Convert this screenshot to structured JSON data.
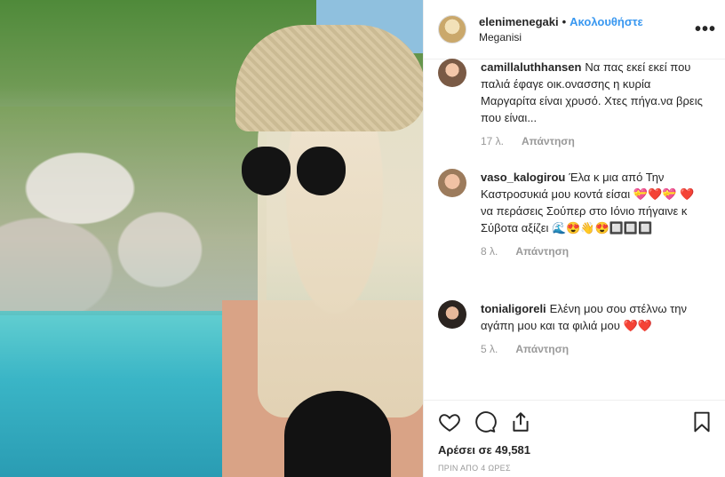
{
  "header": {
    "username": "elenimenegaki",
    "separator": "•",
    "follow_label": "Ακολουθήστε",
    "location": "Meganisi",
    "more_label": "•••"
  },
  "comments": [
    {
      "username": "camillaluthhansen",
      "text": "Να πας εκεί εκεί που παλιά έφαγε οικ.ονασσης η κυρία Μαργαρίτα είναι χρυσό. Χτες πήγα.να βρεις που είναι...",
      "age": "17 λ.",
      "reply": "Απάντηση"
    },
    {
      "username": "vaso_kalogirou",
      "text": "Έλα κ μια από Την Καστροσυκιά μου κοντά είσαι 💝❤️💝 ❤️ να περάσεις Σούπερ στο Ιόνιο πήγαινε κ Σύβοτα αξίζει 🌊😍👋😍🔲🔲🔲",
      "age": "8 λ.",
      "reply": "Απάντηση"
    },
    {
      "username": "tonialigoreli",
      "text": "Ελένη μου σου στέλνω την αγάπη μου και τα φιλιά μου ❤️❤️",
      "age": "5 λ.",
      "reply": "Απάντηση"
    }
  ],
  "actions": {
    "likes_text": "Αρέσει σε 49,581",
    "posted": "ΠΡΙΝ ΑΠΟ 4 ΩΡΕΣ"
  },
  "icons": [
    "heart-icon",
    "comment-icon",
    "share-icon",
    "bookmark-icon"
  ],
  "colors": {
    "accent": "#3897f0",
    "muted": "#999999",
    "text": "#262626"
  }
}
